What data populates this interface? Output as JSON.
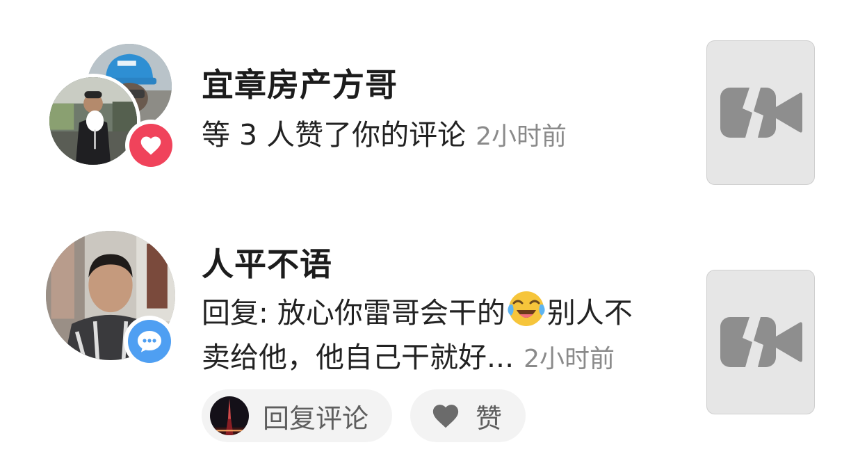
{
  "notifications": [
    {
      "username": "宜章房产方哥",
      "message": "等 3 人赞了你的评论",
      "time": "2小时前",
      "badge_icon": "heart-icon",
      "thumbnail_icon": "video-unavailable-icon"
    },
    {
      "username": "人平不语",
      "message_line1_prefix": "回复: 放心你雷哥会干的",
      "emoji_icon": "face-with-tears-of-joy-emoji",
      "message_line1_suffix": "别人不",
      "message_line2": "卖给他，他自己干就好...",
      "time": "2小时前",
      "badge_icon": "chat-bubble-icon",
      "thumbnail_icon": "video-unavailable-icon",
      "actions": {
        "reply_label": "回复评论",
        "like_label": "赞"
      }
    }
  ],
  "colors": {
    "like_badge": "#f0435b",
    "comment_badge": "#4f9ff2",
    "time_text": "#8a8a8a",
    "pill_background": "#f3f3f3"
  }
}
